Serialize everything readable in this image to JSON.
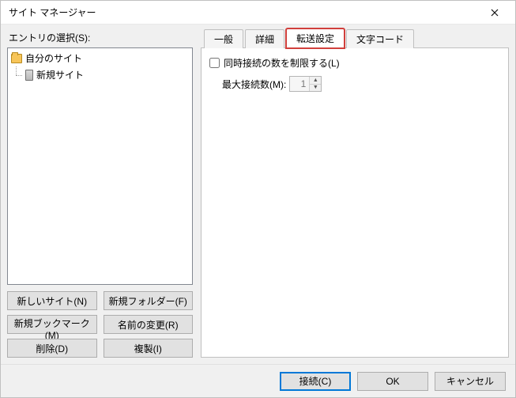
{
  "window": {
    "title": "サイト マネージャー"
  },
  "left": {
    "entry_label": "エントリの選択(S):",
    "tree": {
      "root": {
        "label": "自分のサイト"
      },
      "children": [
        {
          "label": "新規サイト"
        }
      ]
    },
    "buttons": {
      "new_site": "新しいサイト(N)",
      "new_folder": "新規フォルダー(F)",
      "new_bookmark": "新規ブックマーク(M)",
      "rename": "名前の変更(R)",
      "delete": "削除(D)",
      "duplicate": "複製(I)"
    }
  },
  "tabs": {
    "general": "一般",
    "advanced": "詳細",
    "transfer": "転送設定",
    "charset": "文字コード"
  },
  "transfer_tab": {
    "limit_checkbox": "同時接続の数を制限する(L)",
    "max_conn_label": "最大接続数(M):",
    "max_conn_value": "1"
  },
  "dialog": {
    "connect": "接続(C)",
    "ok": "OK",
    "cancel": "キャンセル"
  }
}
